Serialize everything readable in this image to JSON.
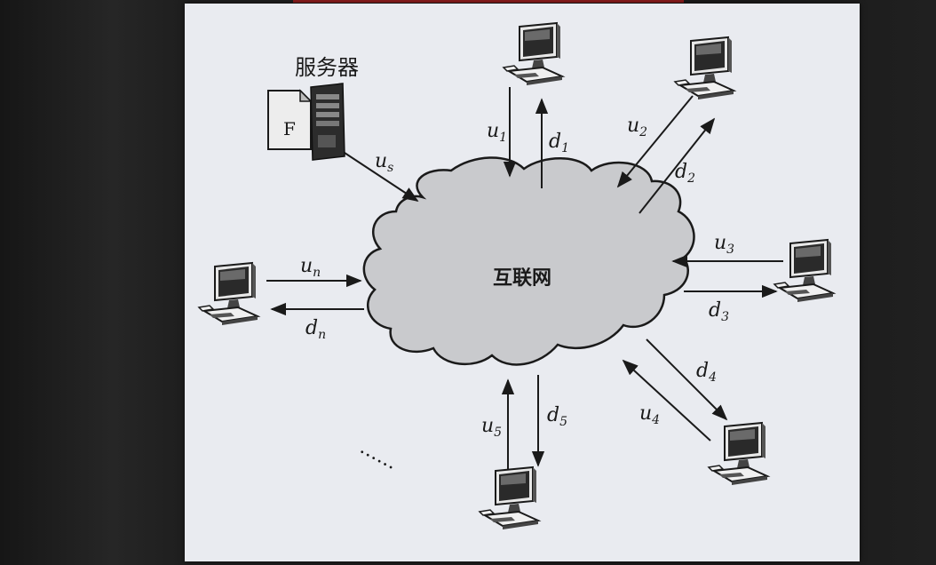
{
  "diagram": {
    "server_label": "服务器",
    "file_label": "F",
    "cloud_label": "互联网",
    "ellipsis": "……",
    "links": {
      "us": {
        "var": "u",
        "sub": "s"
      },
      "u1": {
        "var": "u",
        "sub": "1"
      },
      "d1": {
        "var": "d",
        "sub": "1"
      },
      "u2": {
        "var": "u",
        "sub": "2"
      },
      "d2": {
        "var": "d",
        "sub": "2"
      },
      "u3": {
        "var": "u",
        "sub": "3"
      },
      "d3": {
        "var": "d",
        "sub": "3"
      },
      "d4": {
        "var": "d",
        "sub": "4"
      },
      "u4": {
        "var": "u",
        "sub": "4"
      },
      "u5": {
        "var": "u",
        "sub": "5"
      },
      "d5": {
        "var": "d",
        "sub": "5"
      },
      "un": {
        "var": "u",
        "sub": "n"
      },
      "dn": {
        "var": "d",
        "sub": "n"
      }
    }
  },
  "colors": {
    "slide_background": "#e9ebf0",
    "cloud_fill": "#c9cacd",
    "line": "#1a1a1a",
    "monitor_screen": "#2a2a2a"
  }
}
